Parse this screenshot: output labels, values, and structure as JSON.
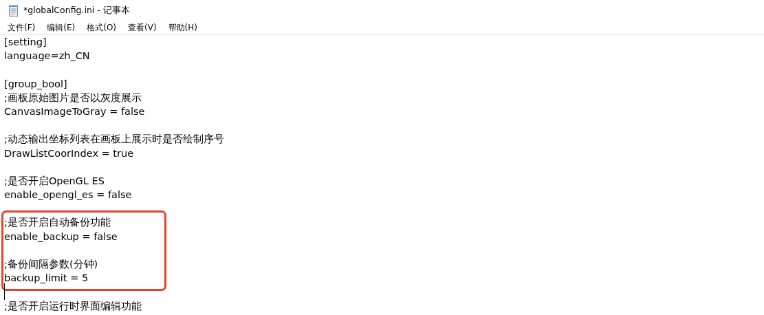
{
  "window": {
    "title": "*globalConfig.ini - 记事本"
  },
  "menu": [
    "文件(F)",
    "编辑(E)",
    "格式(O)",
    "查看(V)",
    "帮助(H)"
  ],
  "lines": [
    {
      "kind": "text",
      "text": "[setting]",
      "highlighted": false,
      "caret": false
    },
    {
      "kind": "text",
      "text": "language=zh_CN",
      "highlighted": false,
      "caret": false
    },
    {
      "kind": "blank",
      "highlighted": false,
      "caret": false
    },
    {
      "kind": "text",
      "text": "[group_bool]",
      "highlighted": false,
      "caret": false
    },
    {
      "kind": "text",
      "text": ";画板原始图片是否以灰度展示",
      "highlighted": false,
      "caret": false
    },
    {
      "kind": "text",
      "text": "CanvasImageToGray = false",
      "highlighted": false,
      "caret": false
    },
    {
      "kind": "blank",
      "highlighted": false,
      "caret": false
    },
    {
      "kind": "text",
      "text": ";动态输出坐标列表在画板上展示时是否绘制序号",
      "highlighted": false,
      "caret": false
    },
    {
      "kind": "text",
      "text": "DrawListCoorIndex = true",
      "highlighted": false,
      "caret": false
    },
    {
      "kind": "blank",
      "highlighted": false,
      "caret": false
    },
    {
      "kind": "text",
      "text": ";是否开启OpenGL ES",
      "highlighted": false,
      "caret": false
    },
    {
      "kind": "text",
      "text": "enable_opengl_es = false",
      "highlighted": false,
      "caret": false
    },
    {
      "kind": "blank",
      "highlighted": false,
      "caret": false
    },
    {
      "kind": "text",
      "text": ";是否开启自动备份功能",
      "highlighted": true,
      "caret": false
    },
    {
      "kind": "text",
      "text": "enable_backup = false",
      "highlighted": true,
      "caret": false
    },
    {
      "kind": "blank",
      "highlighted": true,
      "caret": false
    },
    {
      "kind": "text",
      "text": ";备份间隔参数(分钟)",
      "highlighted": true,
      "caret": false
    },
    {
      "kind": "text",
      "text": "backup_limit = 5",
      "highlighted": true,
      "caret": false
    },
    {
      "kind": "blank",
      "highlighted": false,
      "caret": true
    },
    {
      "kind": "text",
      "text": ";是否开启运行时界面编辑功能",
      "highlighted": false,
      "caret": false
    }
  ]
}
